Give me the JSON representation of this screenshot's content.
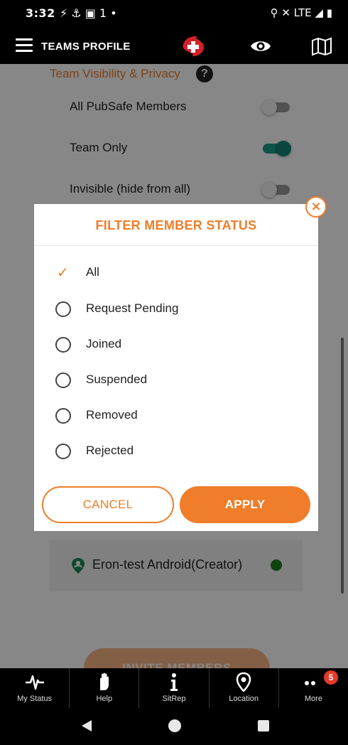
{
  "status_bar": {
    "time": "3:32",
    "icons_left": "⚡ ⚓ ▣ 1 •",
    "icons_right": "⚲ ✕ LTE ◢ ▮"
  },
  "app_bar": {
    "title": "TEAMS PROFILE",
    "icons": [
      "menu-icon",
      "app-logo",
      "eye-icon",
      "map-icon"
    ]
  },
  "background": {
    "section_title": "Team Visibility & Privacy",
    "help_icon": "?",
    "visibility_options": [
      {
        "label": "All PubSafe Members",
        "enabled": false
      },
      {
        "label": "Team Only",
        "enabled": true
      },
      {
        "label": "Invisible (hide from all)",
        "enabled": false
      }
    ],
    "member": {
      "name": "Eron-test Android(Creator)",
      "status_color": "#1b7f1b"
    },
    "invite_button": "INVITE MEMBERS"
  },
  "dialog": {
    "title": "FILTER MEMBER STATUS",
    "options": [
      {
        "label": "All",
        "selected": true
      },
      {
        "label": "Request Pending",
        "selected": false
      },
      {
        "label": "Joined",
        "selected": false
      },
      {
        "label": "Suspended",
        "selected": false
      },
      {
        "label": "Removed",
        "selected": false
      },
      {
        "label": "Rejected",
        "selected": false
      }
    ],
    "cancel_label": "CANCEL",
    "apply_label": "APPLY",
    "close_icon": "×"
  },
  "tab_bar": {
    "tabs": [
      {
        "label": "My Status",
        "icon": "pulse-icon"
      },
      {
        "label": "Help",
        "icon": "hand-icon"
      },
      {
        "label": "SitRep",
        "icon": "info-icon"
      },
      {
        "label": "Location",
        "icon": "location-pin-icon"
      },
      {
        "label": "More",
        "icon": "more-dots-icon",
        "badge": "5"
      }
    ]
  },
  "colors": {
    "accent": "#f07d2a",
    "toggle_on": "#138578",
    "status_online": "#1b7f1b"
  }
}
